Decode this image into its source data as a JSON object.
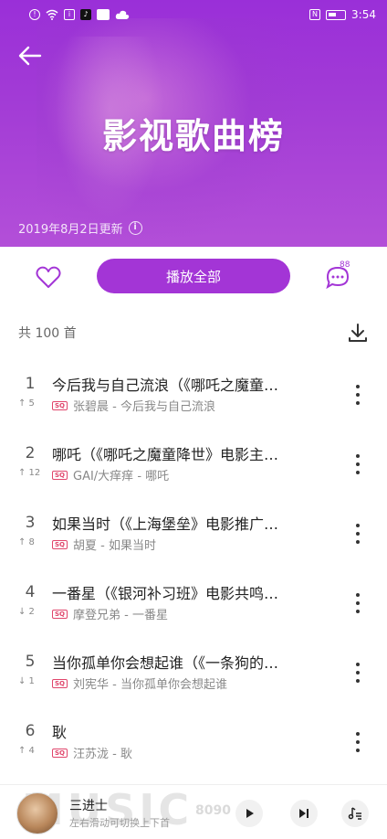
{
  "status_bar": {
    "time": "3:54",
    "left_icons": [
      "alert-icon",
      "wifi-icon",
      "info-icon",
      "tiktok-icon",
      "app-icon",
      "cloud-icon"
    ],
    "right_icons": [
      "nfc-icon",
      "battery-icon"
    ]
  },
  "header": {
    "title": "影视歌曲榜",
    "updated": "2019年8月2日更新",
    "accent": "#a335d6"
  },
  "actions": {
    "play_all_label": "播放全部",
    "comment_count": "88"
  },
  "list": {
    "count_label": "共 100 首"
  },
  "songs": [
    {
      "rank": "1",
      "trend": "↑ 5",
      "title": "今后我与自己流浪（《哪吒之魔童…",
      "badge": "SQ",
      "artist_song": "张碧晨 - 今后我与自己流浪"
    },
    {
      "rank": "2",
      "trend": "↑ 12",
      "title": "哪吒（《哪吒之魔童降世》电影主…",
      "badge": "SQ",
      "artist_song": "GAI/大痒痒 - 哪吒"
    },
    {
      "rank": "3",
      "trend": "↑ 8",
      "title": "如果当时（《上海堡垒》电影推广…",
      "badge": "SQ",
      "artist_song": "胡夏 - 如果当时"
    },
    {
      "rank": "4",
      "trend": "↓ 2",
      "title": "一番星（《银河补习班》电影共鸣…",
      "badge": "SQ",
      "artist_song": "摩登兄弟 - 一番星"
    },
    {
      "rank": "5",
      "trend": "↓ 1",
      "title": "当你孤单你会想起谁（《一条狗的…",
      "badge": "SQ",
      "artist_song": "刘宪华 - 当你孤单你会想起谁"
    },
    {
      "rank": "6",
      "trend": "↑ 4",
      "title": "耿",
      "badge": "SQ",
      "artist_song": "汪苏泷 - 耿"
    }
  ],
  "player": {
    "title": "三进士",
    "hint": "左右滑动可切换上下首",
    "watermark": "MUSIC",
    "watermark_site": "8090"
  }
}
